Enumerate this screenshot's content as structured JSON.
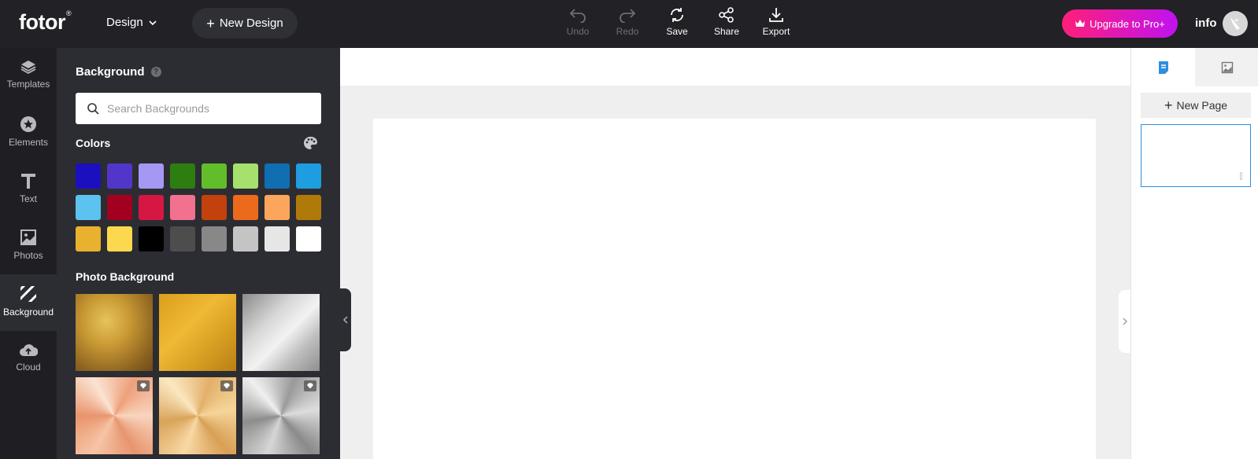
{
  "header": {
    "logo": "fotor",
    "logo_mark": "®",
    "design_menu": "Design",
    "new_design": "New Design",
    "tools": {
      "undo": "Undo",
      "redo": "Redo",
      "save": "Save",
      "share": "Share",
      "export": "Export"
    },
    "upgrade": "Upgrade to Pro+",
    "user": "info"
  },
  "leftnav": [
    {
      "label": "Templates",
      "icon": "layers-icon"
    },
    {
      "label": "Elements",
      "icon": "star-icon"
    },
    {
      "label": "Text",
      "icon": "text-icon"
    },
    {
      "label": "Photos",
      "icon": "image-icon"
    },
    {
      "label": "Background",
      "icon": "stripes-icon",
      "active": true
    },
    {
      "label": "Cloud",
      "icon": "cloud-upload-icon"
    }
  ],
  "panel": {
    "title": "Background",
    "search_placeholder": "Search Backgrounds",
    "colors_title": "Colors",
    "colors": [
      "#1c0fbf",
      "#5236c9",
      "#a598f5",
      "#2e7d11",
      "#62bd2a",
      "#a6e06d",
      "#0f6fb0",
      "#1e9ee0",
      "#5cc2f0",
      "#a3001f",
      "#d61643",
      "#f2718f",
      "#c2410c",
      "#ec6a1c",
      "#fba65c",
      "#b07a0a",
      "#e8b12e",
      "#fcd84e",
      "#000000",
      "#4d4d4d",
      "#888888",
      "#c4c4c4",
      "#e6e6e6",
      "#ffffff"
    ],
    "photo_title": "Photo Background",
    "photos": [
      {
        "name": "gold-texture",
        "pro": false
      },
      {
        "name": "gold-gradient",
        "pro": false
      },
      {
        "name": "silver-gradient",
        "pro": false
      },
      {
        "name": "rose-gold-radial",
        "pro": true
      },
      {
        "name": "champagne-radial",
        "pro": true
      },
      {
        "name": "silver-radial",
        "pro": true
      }
    ]
  },
  "rightpanel": {
    "new_page": "New Page"
  }
}
